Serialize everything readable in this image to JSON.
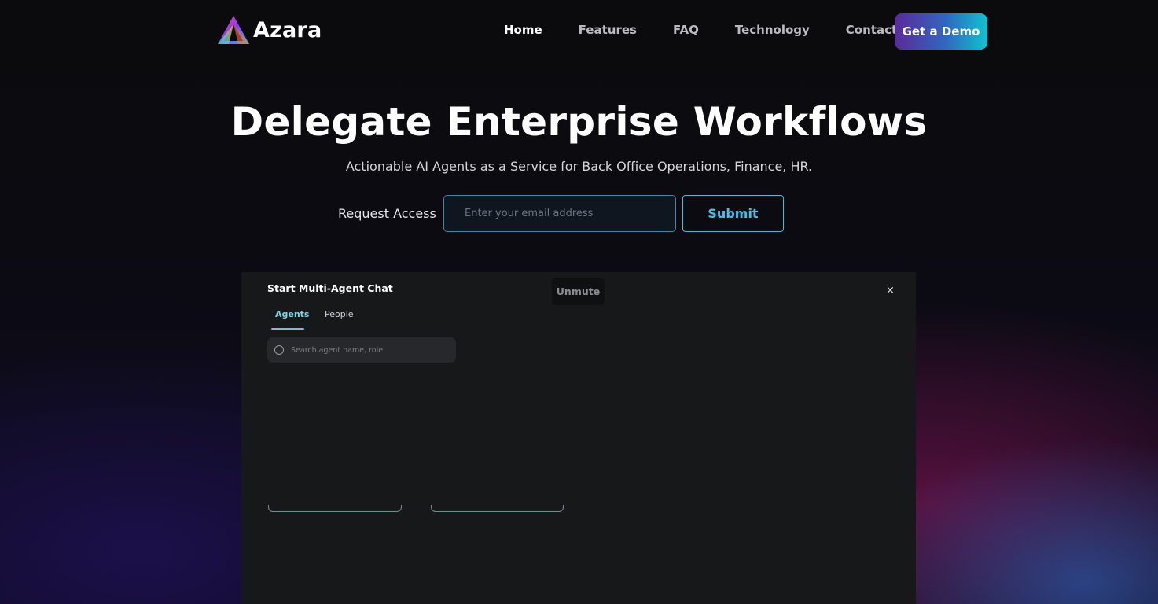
{
  "brand": {
    "name": "Azara"
  },
  "nav": {
    "links": [
      "Home",
      "Features",
      "FAQ",
      "Technology",
      "Contact"
    ],
    "active": "Home",
    "cta": "Get a Demo"
  },
  "hero": {
    "title": "Delegate Enterprise Workflows",
    "subtitle": "Actionable AI Agents as a Service for Back Office Operations, Finance, HR."
  },
  "access_form": {
    "label": "Request Access",
    "email_placeholder": "Enter your email address",
    "submit_label": "Submit"
  },
  "video": {
    "unmute_label": "Unmute",
    "modal": {
      "title": "Start Multi-Agent Chat",
      "close_glyph": "×",
      "tabs": [
        "Agents",
        "People"
      ],
      "active_tab": "Agents",
      "search_placeholder": "Search agent name, role"
    }
  },
  "colors": {
    "accent_cyan": "#41c2e6",
    "cta_gradient_start": "#5a2a9a",
    "cta_gradient_end": "#0fc3cd",
    "background": "#0b0b0d"
  }
}
